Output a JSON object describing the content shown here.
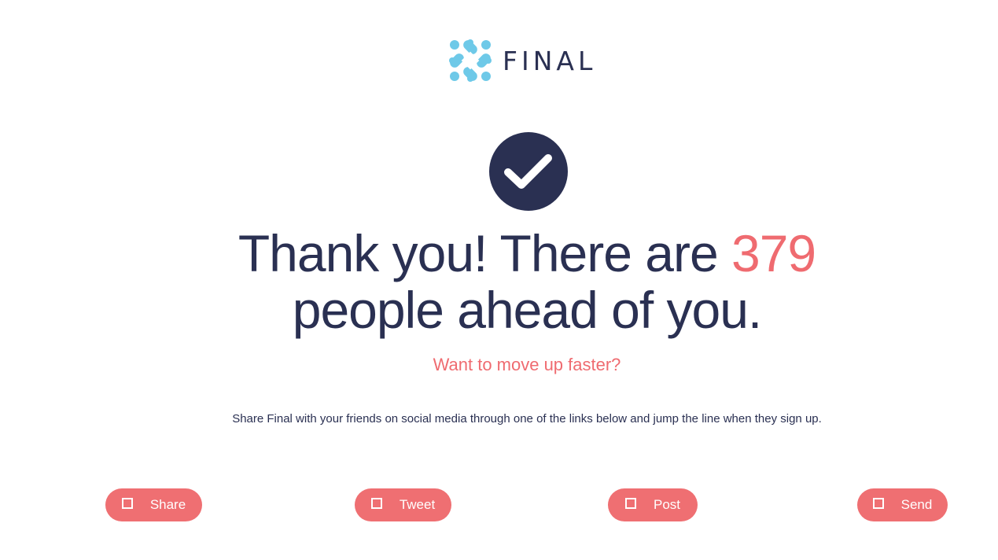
{
  "brand": {
    "name": "FINAL",
    "logo_icon": "diamond-knot-logo-icon",
    "logo_color": "#6ec9e8",
    "text_color": "#2a3052"
  },
  "confirmation": {
    "icon": "checkmark-icon",
    "headline_before": "Thank you! There are ",
    "count": "379",
    "headline_after": " people ahead of you.",
    "subhead": "Want to move up faster?",
    "body": "Share Final with your friends on social media through one of the links below and jump the line when they sign up."
  },
  "share_buttons": [
    {
      "label": "Share",
      "icon": "square-icon"
    },
    {
      "label": "Tweet",
      "icon": "square-icon"
    },
    {
      "label": "Post",
      "icon": "square-icon"
    },
    {
      "label": "Send",
      "icon": "square-icon"
    }
  ],
  "colors": {
    "accent": "#ef6b70",
    "dark": "#2a3052",
    "background": "#ffffff"
  }
}
